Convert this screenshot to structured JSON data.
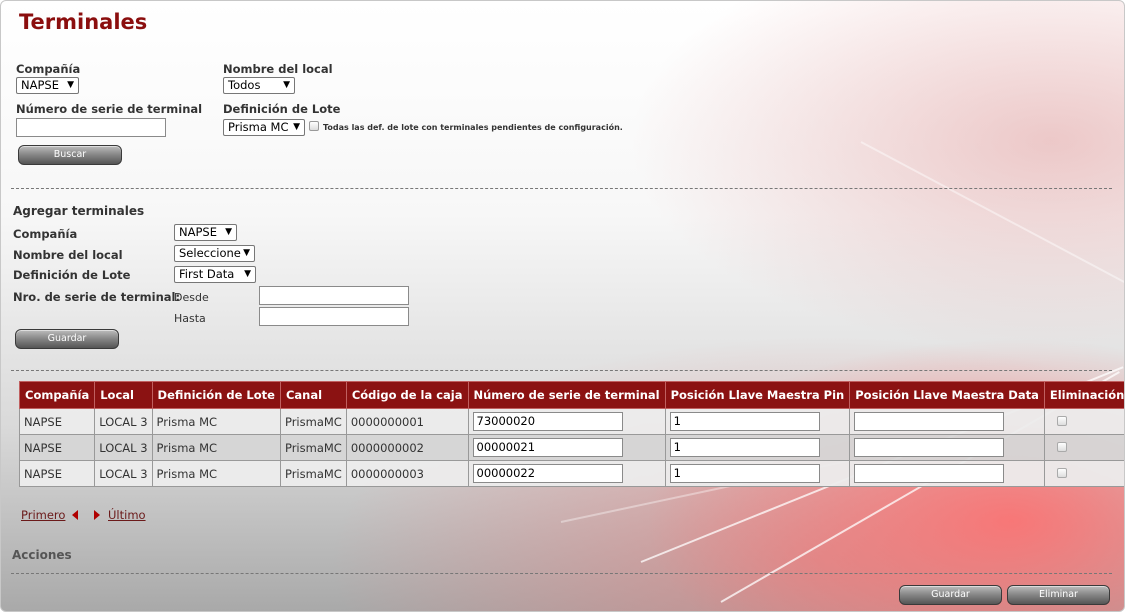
{
  "page": {
    "title": "Terminales"
  },
  "filters": {
    "company_label": "Compañía",
    "company_value": "NAPSE",
    "store_label": "Nombre del local",
    "store_value": "Todos",
    "serial_label": "Número de serie de terminal",
    "serial_value": "",
    "lot_label": "Definición de Lote",
    "lot_value": "Prisma MC",
    "pending_checkbox_label": "Todas las def. de lote con terminales pendientes de configuración.",
    "search_button": "Buscar"
  },
  "add_section": {
    "heading": "Agregar terminales",
    "company_label": "Compañía",
    "company_value": "NAPSE",
    "store_label": "Nombre del local",
    "store_value": "Seleccione",
    "lot_label": "Definición de Lote",
    "lot_value": "First Data",
    "serial_label": "Nro. de serie de terminal:",
    "from_label": "Desde",
    "from_value": "",
    "to_label": "Hasta",
    "to_value": "",
    "save_button": "Guardar"
  },
  "table": {
    "headers": [
      "Compañía",
      "Local",
      "Definición de Lote",
      "Canal",
      "Código de la caja",
      "Número de serie de terminal",
      "Posición Llave Maestra Pin",
      "Posición Llave Maestra Data",
      "Eliminación"
    ],
    "rows": [
      {
        "company": "NAPSE",
        "store": "LOCAL 3",
        "lot": "Prisma MC",
        "channel": "PrismaMC",
        "box_code": "0000000001",
        "serial": "73000020",
        "pin_pos": "1",
        "data_pos": "",
        "delete": false
      },
      {
        "company": "NAPSE",
        "store": "LOCAL 3",
        "lot": "Prisma MC",
        "channel": "PrismaMC",
        "box_code": "0000000002",
        "serial": "00000021",
        "pin_pos": "1",
        "data_pos": "",
        "delete": false
      },
      {
        "company": "NAPSE",
        "store": "LOCAL 3",
        "lot": "Prisma MC",
        "channel": "PrismaMC",
        "box_code": "0000000003",
        "serial": "00000022",
        "pin_pos": "1",
        "data_pos": "",
        "delete": false
      }
    ]
  },
  "pagination": {
    "first": "Primero",
    "last": "Último"
  },
  "actions": {
    "heading": "Acciones",
    "save_button": "Guardar",
    "delete_button": "Eliminar"
  },
  "colors": {
    "accent": "#8b1212",
    "title": "#8b0e0e"
  },
  "icons": {
    "prev": "caret-left-icon",
    "next": "caret-right-icon",
    "dropdown": "dropdown-arrow-icon"
  }
}
